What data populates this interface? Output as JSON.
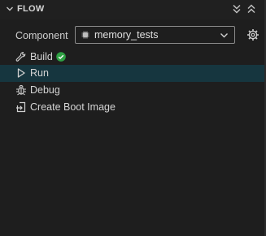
{
  "panel": {
    "title": "FLOW",
    "collapse_icon": "chevron-down-icon",
    "collapse_all_icon": "double-chevron-down-icon",
    "expand_all_icon": "double-chevron-up-icon"
  },
  "component": {
    "label": "Component",
    "selected": "memory_tests",
    "chip_icon": "chip-icon",
    "settings_icon": "gear-icon"
  },
  "flow_items": [
    {
      "label": "Build",
      "icon": "build-tools-icon",
      "status": "success",
      "status_color": "#2ea043",
      "selected": false
    },
    {
      "label": "Run",
      "icon": "play-icon",
      "selected": true
    },
    {
      "label": "Debug",
      "icon": "bug-icon",
      "selected": false
    },
    {
      "label": "Create Boot Image",
      "icon": "boot-image-icon",
      "selected": false
    }
  ],
  "colors": {
    "background": "#1e1e1e",
    "selected_row": "#16363f",
    "success": "#2ea043"
  }
}
